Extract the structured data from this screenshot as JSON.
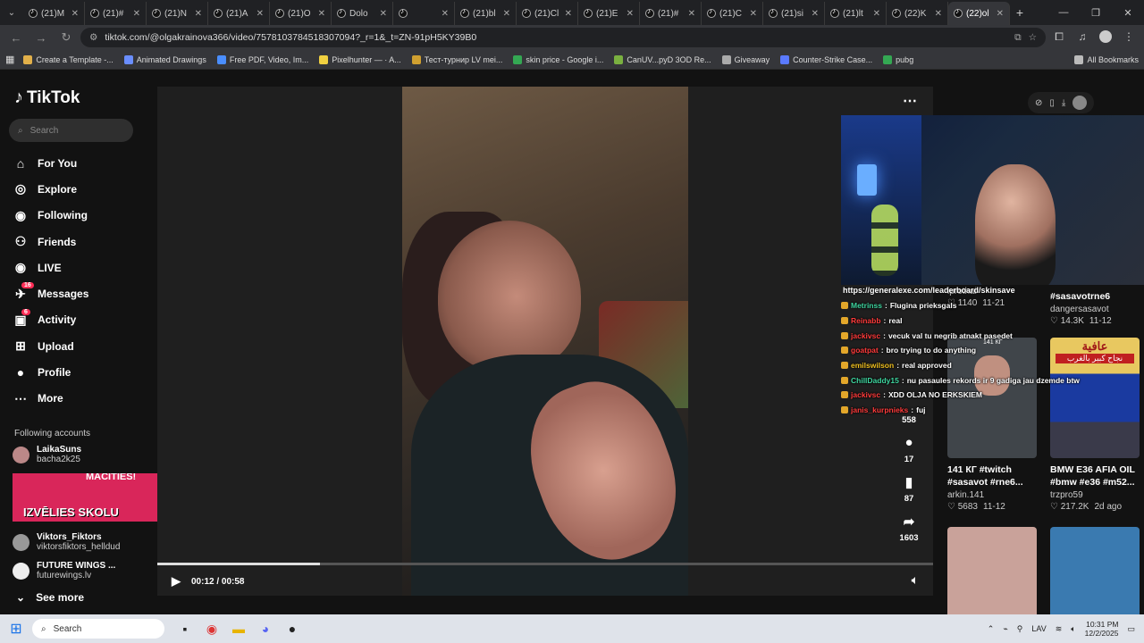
{
  "browser": {
    "tabs": [
      "(21)M",
      "(21)#",
      "(21)N",
      "(21)A",
      "(21)O",
      "Dolo",
      "",
      "(21)bl",
      "(21)Cl",
      "(21)E",
      "(21)#",
      "(21)C",
      "(21)si",
      "(21)lt",
      "(22)K",
      "(22)ol"
    ],
    "active_tab_index": 15,
    "url": "tiktok.com/@olgakrainova366/video/7578103784518307094?_r=1&_t=ZN-91pH5KY39B0",
    "bookmarks": [
      "Create a Template -...",
      "Animated Drawings",
      "Free PDF, Video, Im...",
      "Pixelhunter — · A...",
      "Тест-турнир LV mei...",
      "skin price - Google i...",
      "CanUV...pyD 3OD Re...",
      "Giveaway",
      "Counter-Strike Case...",
      "pubg"
    ],
    "all_bookmarks": "All Bookmarks"
  },
  "sidebar": {
    "logo": "TikTok",
    "search_placeholder": "Search",
    "nav": [
      {
        "label": "For You",
        "icon": "home-icon"
      },
      {
        "label": "Explore",
        "icon": "compass-icon"
      },
      {
        "label": "Following",
        "icon": "following-avatar-icon"
      },
      {
        "label": "Friends",
        "icon": "friends-icon"
      },
      {
        "label": "LIVE",
        "icon": "live-icon"
      },
      {
        "label": "Messages",
        "icon": "messages-icon",
        "badge": "16"
      },
      {
        "label": "Activity",
        "icon": "activity-icon",
        "badge": "6"
      },
      {
        "label": "Upload",
        "icon": "upload-icon"
      },
      {
        "label": "Profile",
        "icon": "profile-icon"
      },
      {
        "label": "More",
        "icon": "more-icon"
      }
    ],
    "following_title": "Following accounts",
    "accounts": [
      {
        "name": "LaikaSuns",
        "handle": "bacha2k25"
      },
      {
        "name": "Viktors_Fiktors",
        "handle": "viktorsfiktors_helldud"
      },
      {
        "name": "FUTURE WINGS ...",
        "handle": "futurewings.lv"
      }
    ],
    "promo_top": "MACITIES!",
    "promo_text": "IZVĒLIES SKOLU",
    "see_more": "See more"
  },
  "player": {
    "time": "00:12 / 00:58",
    "progress_fraction": 0.21,
    "counts": {
      "likes": "558",
      "comments": "17",
      "saves": "87",
      "shares": "1603"
    },
    "author_partial": "olgakrainova366"
  },
  "stream_overlay": {
    "link": "https://generalexe.com/leaderboard/skinsave",
    "chat": [
      {
        "user": "Metrinss",
        "msg": "Flugina prieksgals",
        "color": "#3fd6a0"
      },
      {
        "user": "Reinabb",
        "msg": "real",
        "color": "#ff3b3b"
      },
      {
        "user": "jackivsc",
        "msg": "vecuk val tu negrib atnakt pasedet",
        "color": "#ff3b3b"
      },
      {
        "user": "goatpat",
        "msg": "bro trying to do anything",
        "color": "#ff3b3b"
      },
      {
        "user": "emilswilson",
        "msg": "real approved",
        "color": "#f0c020"
      },
      {
        "user": "ChillDaddy15",
        "msg": "nu pasaules rekords ir 9 gadiga jau dzemde btw",
        "color": "#3fd6a0"
      },
      {
        "user": "jackivsc",
        "msg": "XDD OLJA NO ERKSKIEM",
        "color": "#ff3b3b"
      },
      {
        "user": "janis_kurpnieks",
        "msg": "fuj",
        "color": "#ff3b3b"
      }
    ]
  },
  "grid": [
    {
      "caption": "",
      "author": "iprothai",
      "views": "1140",
      "date": "11-21",
      "thumb": "#3a3a3a"
    },
    {
      "caption": "#sasavotrne6",
      "author": "dangersasavot",
      "views": "14.3K",
      "date": "11-12",
      "thumb": "#2a2a2a"
    },
    {
      "caption": "141 КГ #twitch #sasavot #rne6...",
      "author": "arkin.141",
      "views": "5683",
      "date": "11-12",
      "thumb": "#40454a"
    },
    {
      "caption": "BMW E36 AFIA OIL #bmw #e36 #m52...",
      "author": "trzpro59",
      "views": "217.2K",
      "date": "2d ago",
      "thumb": "#2a44a0"
    },
    {
      "caption": "",
      "author": "",
      "views": "",
      "date": "",
      "thumb": "#c9a29a"
    },
    {
      "caption": "",
      "author": "",
      "views": "",
      "date": "",
      "thumb": "#3a7ab0"
    }
  ],
  "grid_overlay_text": {
    "bmw_arabic": "عافية",
    "bmw_arabic2": "نجاح كبير بالغرب",
    "small_label": "141 КГ"
  },
  "taskbar": {
    "search": "Search",
    "lang": "LAV",
    "time": "10:31 PM",
    "date": "12/2/2025"
  }
}
